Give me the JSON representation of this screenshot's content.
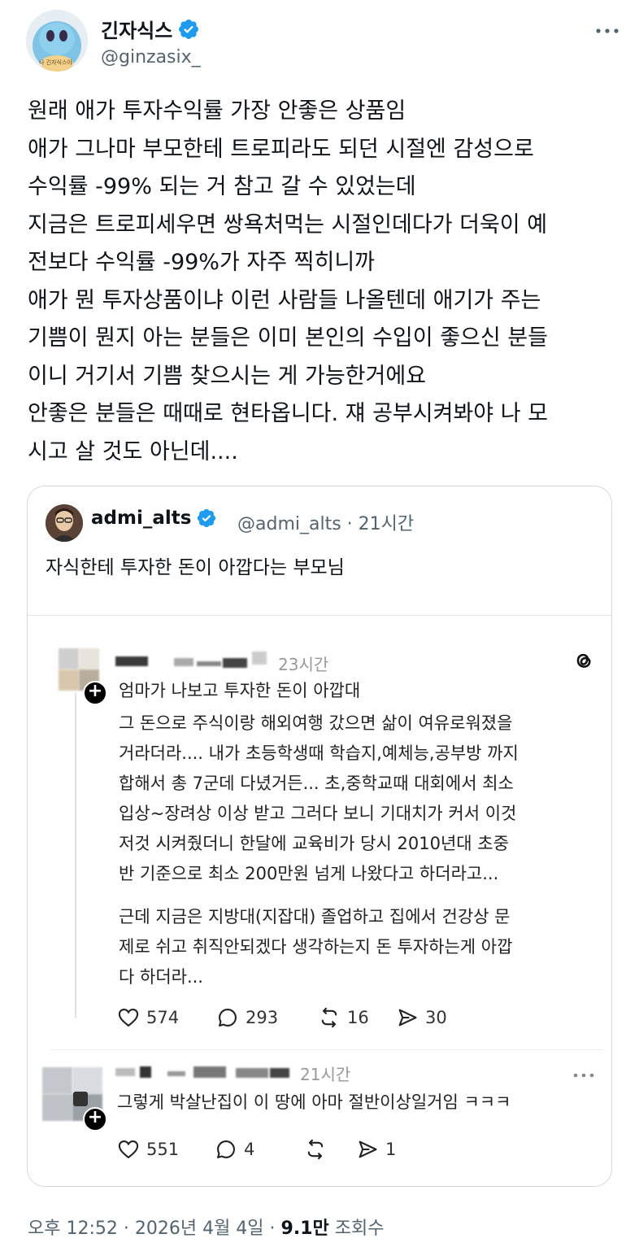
{
  "author": {
    "name": "긴자식스",
    "handle": "@ginzasix_",
    "avatar_caption": "나 긴자식스야",
    "more_icon": "more-horizontal-icon",
    "verified_color": "#1d9bf0"
  },
  "tweet": {
    "lines": [
      "원래 애가 투자수익률 가장 안좋은 상품임",
      "애가 그나마 부모한테 트로피라도 되던 시절엔 감성으로",
      "수익률 -99% 되는 거 참고 갈 수 있었는데",
      "지금은 트로피세우면 쌍욕처먹는 시절인데다가 더욱이 예",
      "전보다 수익률 -99%가 자주 찍히니까",
      "애가 뭔 투자상품이냐 이런 사람들 나올텐데 애기가 주는",
      "기쁨이 뭔지 아는 분들은 이미 본인의 수입이 좋으신 분들",
      "이니 거기서 기쁨 찾으시는 게 가능한거에요",
      "안좋은 분들은 때때로 현타옵니다. 쟤 공부시켜봐야 나 모",
      "시고 살 것도 아닌데...."
    ]
  },
  "quote": {
    "name": "admi_alts",
    "handle_time": "@admi_alts · 21시간",
    "text": "자식한테 투자한 돈이 아깝다는 부모님"
  },
  "threads_post": {
    "time": "23시간",
    "lines": [
      "엄마가 나보고 투자한 돈이 아깝대",
      "그 돈으로 주식이랑 해외여행 갔으면 삶이 여유로워졌을",
      "거라더라.... 내가 초등학생때 학습지,예체능,공부방 까지",
      "합해서 총 7군데 다녔거든... 초,중학교때 대회에서 최소",
      "입상~장려상 이상 받고 그러다 보니 기대치가 커서 이것",
      "저것 시켜줬더니 한달에 교육비가 당시 2010년대 초중",
      "반 기준으로 최소 200만원 넘게 나왔다고 하더라고..."
    ],
    "lines2": [
      "근데 지금은 지방대(지잡대) 졸업하고 집에서 건강상 문",
      "제로 쉬고 취직안되겠다 생각하는지 돈 투자하는게 아깝",
      "다 하더라..."
    ],
    "likes": "574",
    "comments": "293",
    "reposts": "16",
    "shares": "30"
  },
  "reply": {
    "time": "21시간",
    "text": "그렇게 박살난집이 이 땅에 아마 절반이상일거임 ㅋㅋㅋ",
    "likes": "551",
    "comments": "4",
    "reposts": "",
    "shares": "1"
  },
  "footer": {
    "time": "오후 12:52 · 2026년 4월 4일 · ",
    "views": "9.1만",
    "views_label": " 조회수"
  }
}
